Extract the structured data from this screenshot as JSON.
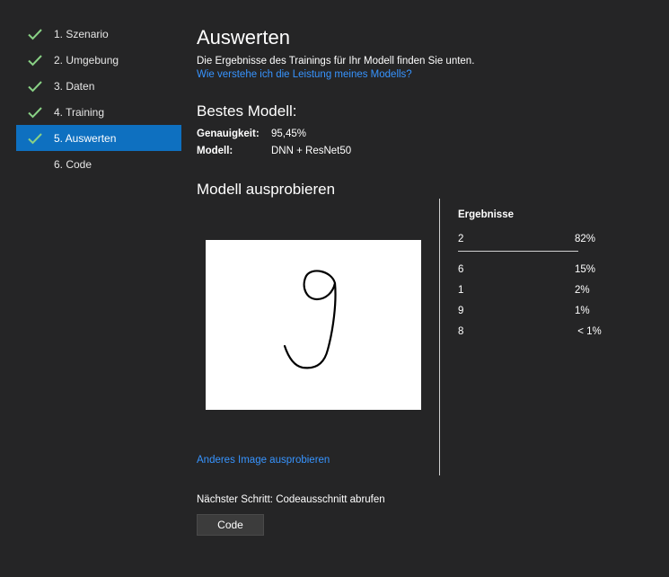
{
  "sidebar": {
    "items": [
      {
        "label": "1. Szenario",
        "done": true
      },
      {
        "label": "2. Umgebung",
        "done": true
      },
      {
        "label": "3. Daten",
        "done": true
      },
      {
        "label": "4. Training",
        "done": true
      },
      {
        "label": "5. Auswerten",
        "done": true,
        "active": true
      },
      {
        "label": "6. Code",
        "done": false
      }
    ]
  },
  "main": {
    "title": "Auswerten",
    "description": "Die Ergebnisse des Trainings für Ihr Modell finden Sie unten.",
    "help_link": "Wie verstehe ich die Leistung meines Modells?",
    "best_model": {
      "title": "Bestes Modell:",
      "accuracy_label": "Genauigkeit:",
      "accuracy_value": "95,45%",
      "model_label": "Modell:",
      "model_value": "DNN + ResNet50"
    },
    "try_model": {
      "title": "Modell ausprobieren",
      "other_image_link": "Anderes Image ausprobieren"
    },
    "results": {
      "header": "Ergebnisse",
      "top": {
        "label": "2",
        "percent": "82%"
      },
      "rows": [
        {
          "label": "6",
          "percent": "15%"
        },
        {
          "label": "1",
          "percent": "2%"
        },
        {
          "label": "9",
          "percent": "1%"
        },
        {
          "label": "8",
          "percent": " < 1%"
        }
      ]
    },
    "next_step": "Nächster Schritt: Codeausschnitt abrufen",
    "code_button": "Code"
  },
  "colors": {
    "background": "#252526",
    "active": "#0e70c0",
    "link": "#3794ff",
    "check": "#89d185"
  }
}
